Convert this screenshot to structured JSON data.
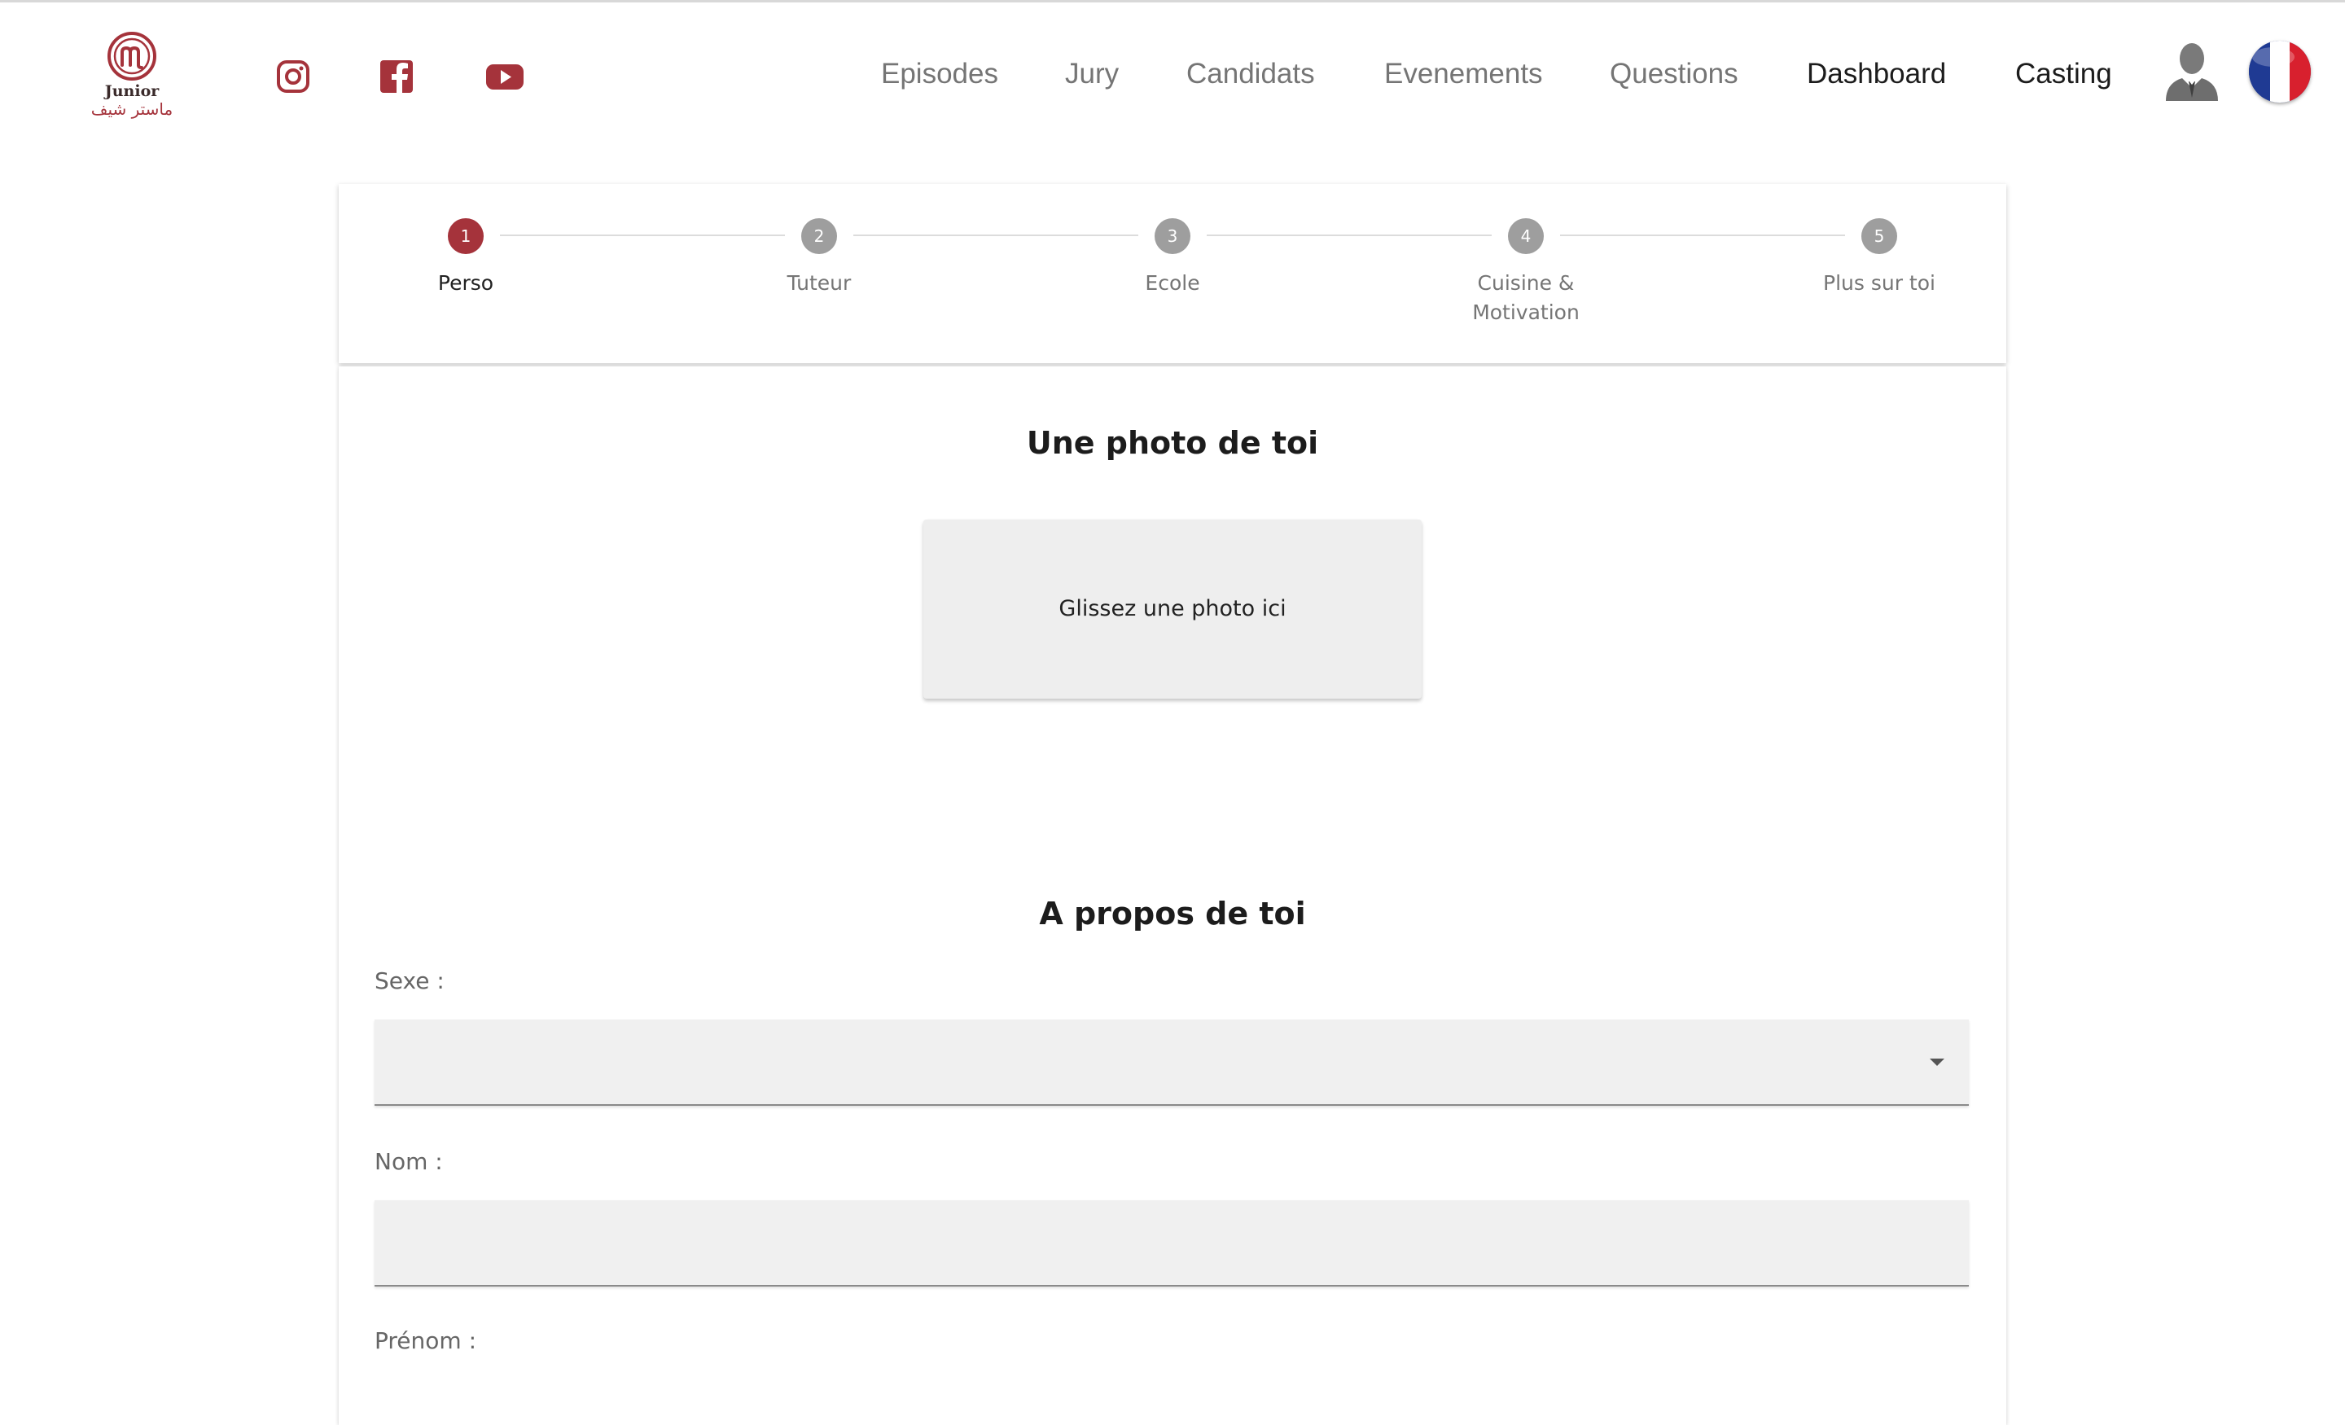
{
  "brand": {
    "logo_text": "Junior",
    "logo_arabic": "ماستر شيف",
    "accent": "#a5333b"
  },
  "social": [
    {
      "name": "instagram",
      "icon": "instagram-icon"
    },
    {
      "name": "facebook",
      "icon": "facebook-icon"
    },
    {
      "name": "youtube",
      "icon": "youtube-icon"
    }
  ],
  "nav": {
    "episodes": "Episodes",
    "jury": "Jury",
    "candidats": "Candidats",
    "evenements": "Evenements",
    "questions": "Questions",
    "dashboard": "Dashboard",
    "casting": "Casting"
  },
  "user_menu": {
    "icon": "user-avatar-icon",
    "language_icon": "french-flag-icon"
  },
  "stepper": {
    "steps": [
      {
        "number": "1",
        "label": "Perso",
        "active": true
      },
      {
        "number": "2",
        "label": "Tuteur",
        "active": false
      },
      {
        "number": "3",
        "label": "Ecole",
        "active": false
      },
      {
        "number": "4",
        "label": "Cuisine &\nMotivation",
        "active": false
      },
      {
        "number": "5",
        "label": "Plus sur toi",
        "active": false
      }
    ]
  },
  "photo_section": {
    "title": "Une photo de toi",
    "dropzone_text": "Glissez une photo ici"
  },
  "about_section": {
    "title": "A propos de toi",
    "fields": [
      {
        "label": "Sexe :",
        "value": "",
        "type": "select"
      },
      {
        "label": "Nom :",
        "value": "",
        "type": "text"
      },
      {
        "label": "Prénom :",
        "value": "",
        "type": "text"
      }
    ]
  }
}
